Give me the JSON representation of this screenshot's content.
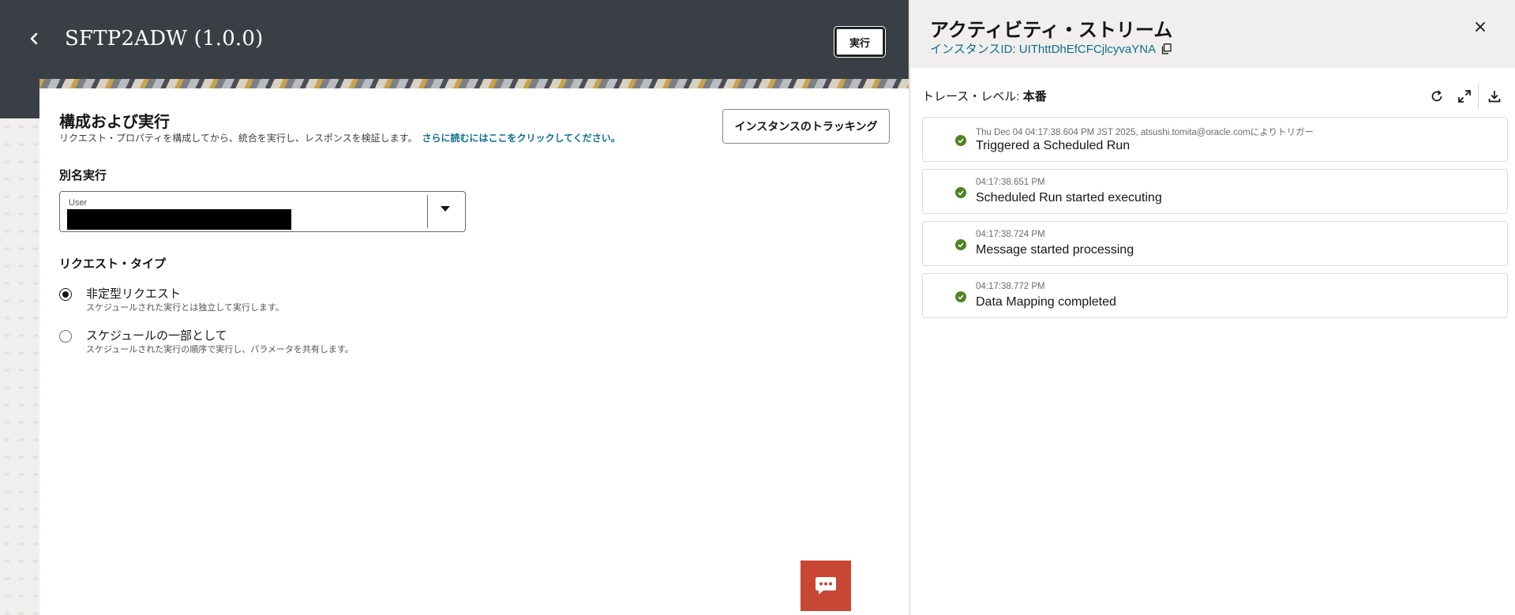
{
  "app": {
    "title": "SFTP2ADW (1.0.0)",
    "run_label": "実行"
  },
  "config": {
    "heading": "構成および実行",
    "description": "リクエスト・プロパティを構成してから、統合を実行し、レスポンスを検証します。",
    "read_more": "さらに読むにはここをクリックしてください。",
    "track_button": "インスタンスのトラッキング",
    "alias_label": "別名実行",
    "user_field_label": "User",
    "request_type_label": "リクエスト・タイプ",
    "options": [
      {
        "title": "非定型リクエスト",
        "subtitle": "スケジュールされた実行とは独立して実行します。",
        "selected": true
      },
      {
        "title": "スケジュールの一部として",
        "subtitle": "スケジュールされた実行の順序で実行し、パラメータを共有します。",
        "selected": false
      }
    ]
  },
  "activity": {
    "title": "アクティビティ・ストリーム",
    "instance_id": "インスタンスID: UIThttDhEfCFCjlcyvaYNA",
    "trace_label": "トレース・レベル:",
    "trace_value": "本番",
    "events": [
      {
        "time": "Thu Dec 04 04:17:38.604 PM JST 2025, atsushi.tomita@oracle.comによりトリガー",
        "message": "Triggered a Scheduled Run",
        "status": "success"
      },
      {
        "time": "04:17:38.651 PM",
        "message": "Scheduled Run started executing",
        "status": "success"
      },
      {
        "time": "04:17:38.724 PM",
        "message": "Message started processing",
        "status": "success"
      },
      {
        "time": "04:17:38.772 PM",
        "message": "Data Mapping completed",
        "status": "success"
      }
    ]
  },
  "icons": {
    "back": "chevron-left-icon",
    "copy": "copy-icon",
    "close": "close-icon",
    "refresh": "refresh-icon",
    "expand": "expand-icon",
    "download": "download-icon",
    "chat": "chat-icon",
    "status": "check-circle-icon"
  },
  "colors": {
    "header": "#3a3f45",
    "link": "#0e6e8f",
    "success": "#508223",
    "chat": "#c74634"
  }
}
